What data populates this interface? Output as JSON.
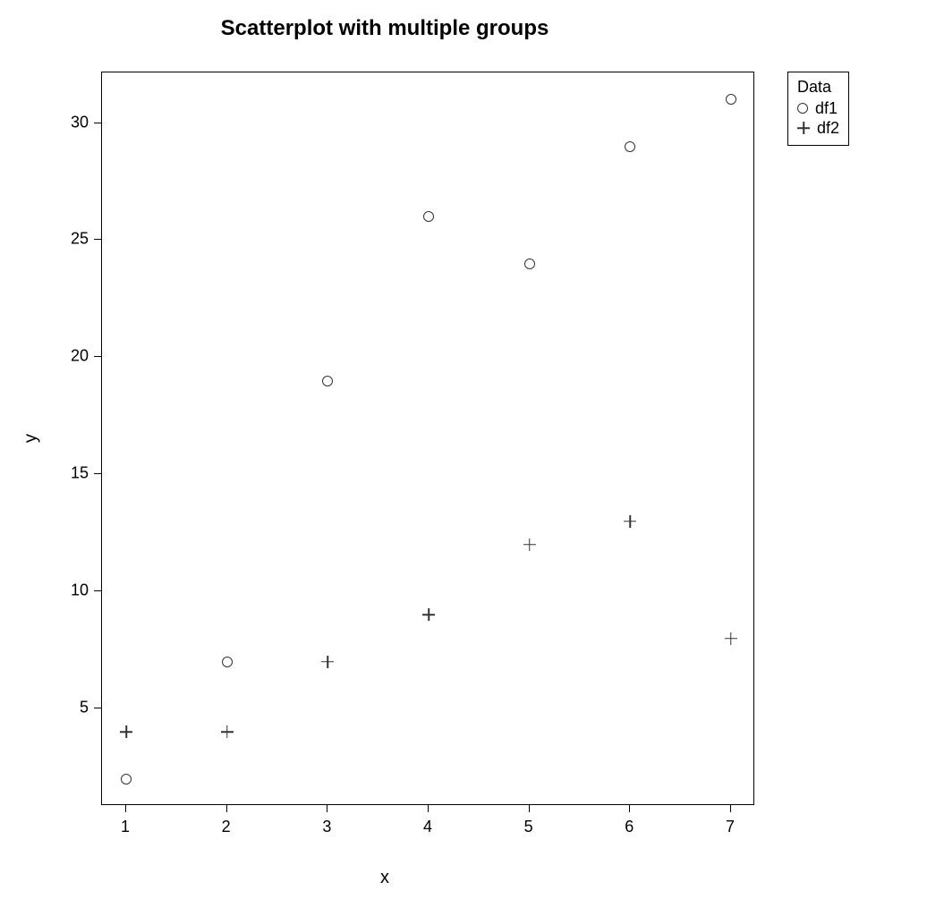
{
  "chart_data": {
    "type": "scatter",
    "title": "Scatterplot with multiple groups",
    "xlabel": "x",
    "ylabel": "y",
    "xlim": [
      1,
      7
    ],
    "ylim": [
      2,
      31
    ],
    "x_ticks": [
      1,
      2,
      3,
      4,
      5,
      6,
      7
    ],
    "y_ticks": [
      5,
      10,
      15,
      20,
      25,
      30
    ],
    "series": [
      {
        "name": "df1",
        "symbol": "circle",
        "x": [
          1,
          2,
          3,
          4,
          5,
          6,
          7
        ],
        "y": [
          2,
          7,
          19,
          26,
          24,
          29,
          31
        ]
      },
      {
        "name": "df2",
        "symbol": "plus",
        "x": [
          1,
          2,
          3,
          4,
          5,
          6,
          7
        ],
        "y": [
          4,
          4,
          7,
          9,
          12,
          13,
          8
        ]
      }
    ],
    "legend": {
      "title": "Data",
      "entries": [
        "df1",
        "df2"
      ]
    }
  }
}
